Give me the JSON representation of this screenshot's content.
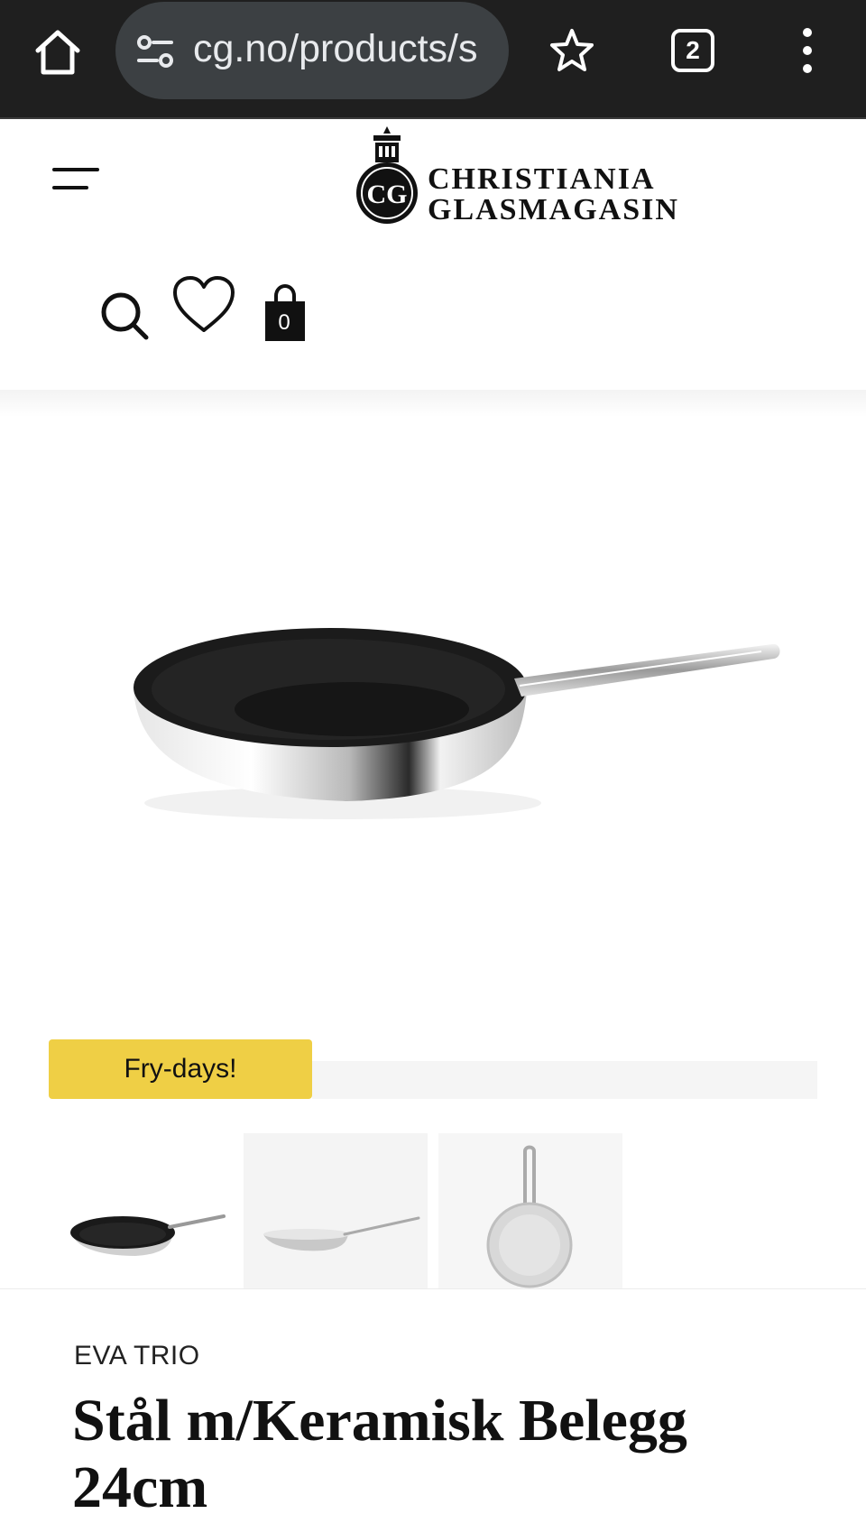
{
  "browser": {
    "url": "cg.no/products/s",
    "tab_count": "2"
  },
  "header": {
    "logo_line1": "CHRISTIANIA",
    "logo_line2": "GLASMAGASIN",
    "logo_monogram": "CG",
    "cart_count": "0"
  },
  "gallery": {
    "badge": "Fry-days!"
  },
  "product": {
    "brand": "EVA TRIO",
    "title": "Stål m/Keramisk Belegg 24cm"
  },
  "colors": {
    "badge": "#efcf45",
    "chrome": "#1f1f1f",
    "urlbar": "#3c4043"
  }
}
